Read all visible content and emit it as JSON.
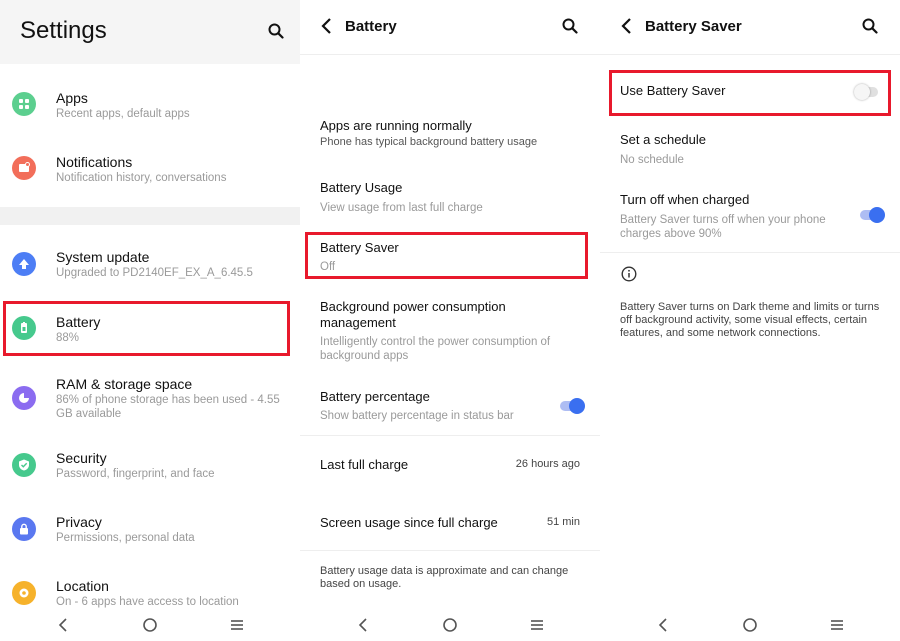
{
  "settings": {
    "title": "Settings",
    "items": [
      {
        "title": "Apps",
        "subtitle": "Recent apps, default apps"
      },
      {
        "title": "Notifications",
        "subtitle": "Notification history, conversations"
      },
      {
        "title": "System update",
        "subtitle": "Upgraded to PD2140EF_EX_A_6.45.5"
      },
      {
        "title": "Battery",
        "subtitle": "88%"
      },
      {
        "title": "RAM & storage space",
        "subtitle": "86% of phone storage has been used - 4.55 GB available"
      },
      {
        "title": "Security",
        "subtitle": "Password, fingerprint, and face"
      },
      {
        "title": "Privacy",
        "subtitle": "Permissions, personal data"
      },
      {
        "title": "Location",
        "subtitle": "On - 6 apps have access to location"
      }
    ]
  },
  "battery": {
    "title": "Battery",
    "status_title": "Apps are running normally",
    "status_subtitle": "Phone has typical background battery usage",
    "items": [
      {
        "title": "Battery Usage",
        "subtitle": "View usage from last full charge"
      },
      {
        "title": "Battery Saver",
        "subtitle": "Off"
      },
      {
        "title": "Background power consumption management",
        "subtitle": "Intelligently control the power consumption of background apps"
      },
      {
        "title": "Battery percentage",
        "subtitle": "Show battery percentage in status bar"
      }
    ],
    "battery_percentage_on": true,
    "last_full_charge": {
      "label": "Last full charge",
      "value": "26 hours ago"
    },
    "screen_usage": {
      "label": "Screen usage since full charge",
      "value": "51 min"
    },
    "footnote": "Battery usage data is approximate and can change based on usage."
  },
  "battery_saver": {
    "title": "Battery Saver",
    "use_label": "Use Battery Saver",
    "use_on": false,
    "schedule_title": "Set a schedule",
    "schedule_value": "No schedule",
    "turn_off_title": "Turn off when charged",
    "turn_off_subtitle": "Battery Saver turns off when your phone charges above 90%",
    "turn_off_on": true,
    "info_text": "Battery Saver turns on Dark theme and limits or turns off background activity, some visual effects, certain features, and some network connections."
  },
  "colors": {
    "accent": "#3a6ff0",
    "highlight": "#e8192c",
    "icon_apps": "#5ccf8f",
    "icon_notifications": "#f26e5a",
    "icon_system_update": "#4d7ef5",
    "icon_battery": "#46c98d",
    "icon_ram": "#8b6cf0",
    "icon_security": "#46c98d",
    "icon_privacy": "#5a78f0",
    "icon_location": "#f6b22b"
  }
}
